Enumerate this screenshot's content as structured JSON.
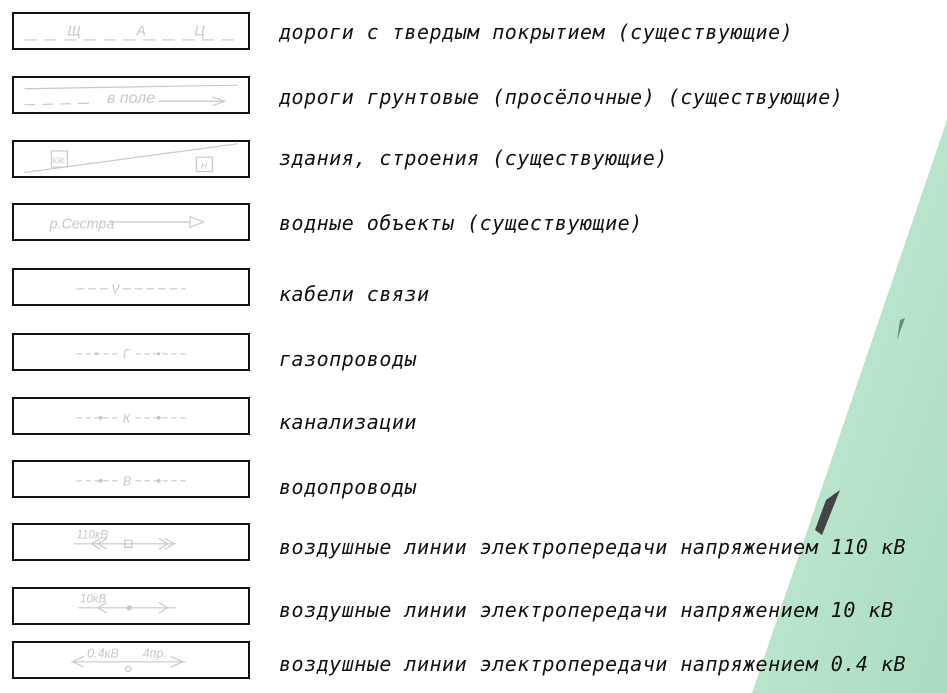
{
  "legend": {
    "items": [
      {
        "symbol_text": [
          "Щ",
          "А",
          "Ц"
        ],
        "label": "дороги с твердым покрытием (существующие)"
      },
      {
        "symbol_text": [
          "в поле"
        ],
        "label": "дороги грунтовые (просёлочные) (существующие)"
      },
      {
        "symbol_text": [
          "КЖ",
          "Н"
        ],
        "label": "здания, строения (существующие)"
      },
      {
        "symbol_text": [
          "р.Сестра"
        ],
        "label": "водные объекты (существующие)"
      },
      {
        "symbol_text": [
          "V"
        ],
        "label": "кабели связи"
      },
      {
        "symbol_text": [
          "Г"
        ],
        "label": "газопроводы"
      },
      {
        "symbol_text": [
          "К"
        ],
        "label": "канализации"
      },
      {
        "symbol_text": [
          "В"
        ],
        "label": "водопроводы"
      },
      {
        "symbol_text": [
          "110кВ"
        ],
        "label": "воздушные линии электропередачи напряжением 110 кВ"
      },
      {
        "symbol_text": [
          "10кВ"
        ],
        "label": "воздушные линии электропередачи напряжением 10 кВ"
      },
      {
        "symbol_text": [
          "0.4кВ",
          "4пр."
        ],
        "label": "воздушные линии электропередачи напряжением 0.4 кВ"
      }
    ]
  },
  "colors": {
    "symbol_stroke": "#c8c8c8",
    "text": "#111111",
    "map_fill": "#bfe6cf"
  }
}
